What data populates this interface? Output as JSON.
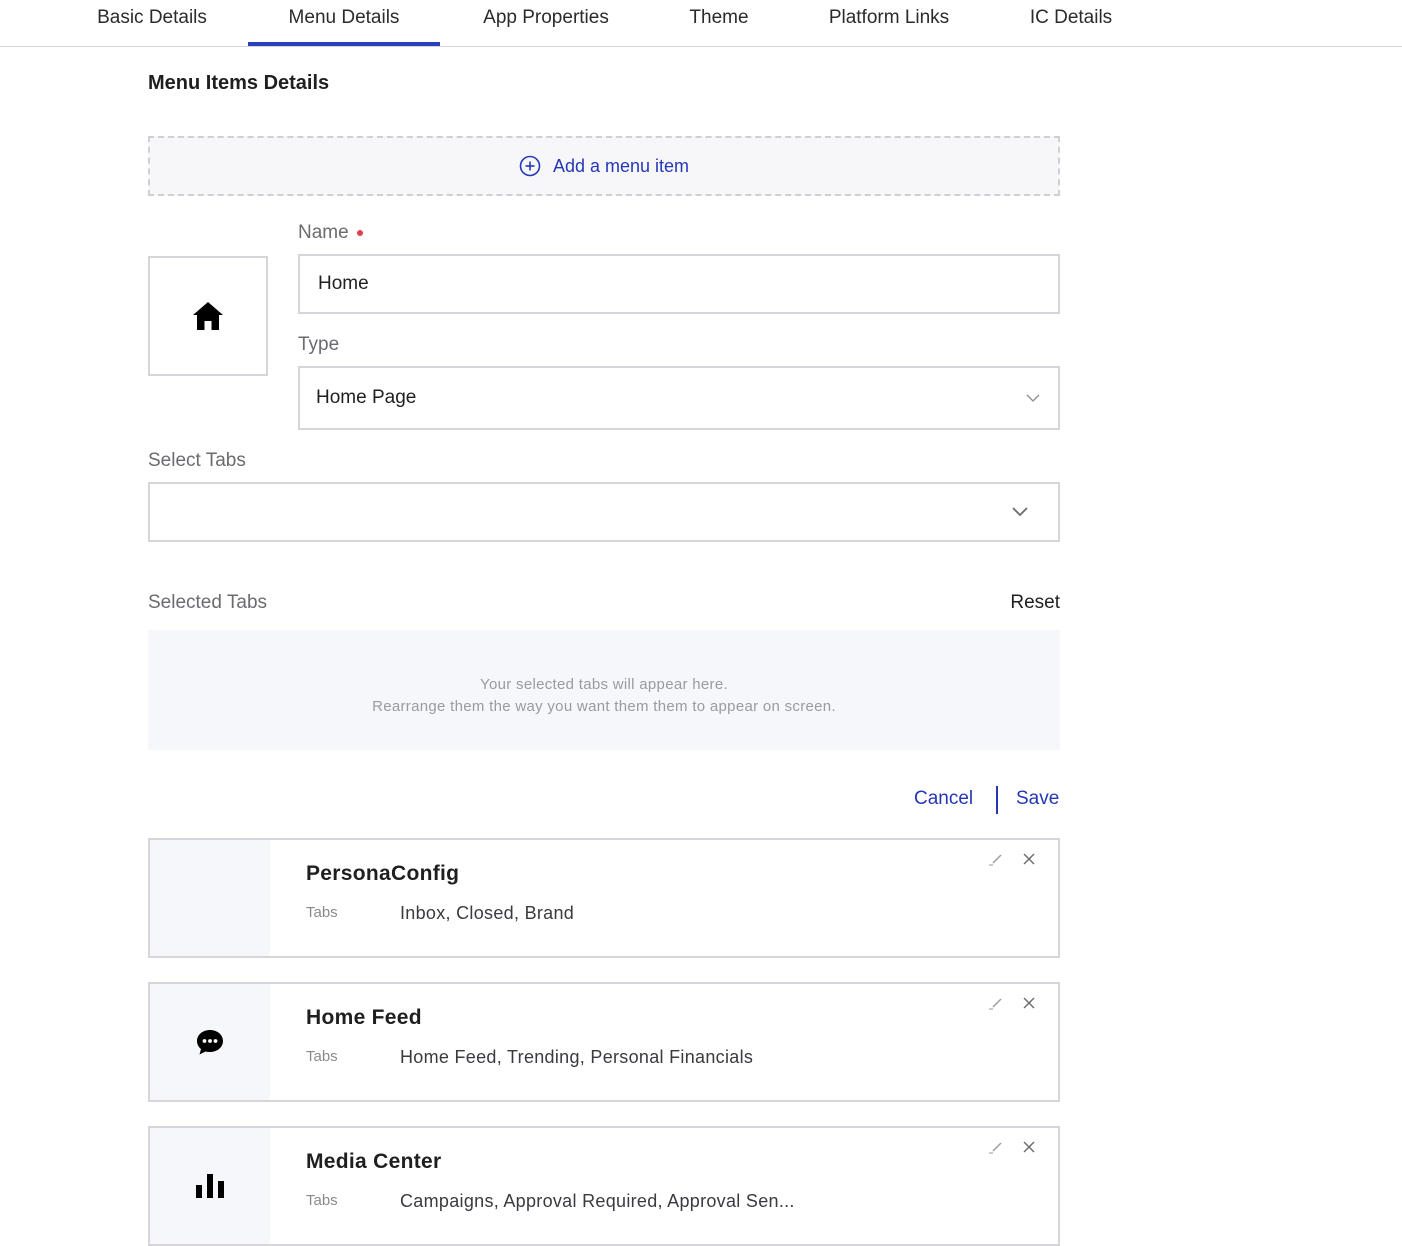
{
  "tabs": [
    {
      "label": "Basic Details"
    },
    {
      "label": "Menu Details"
    },
    {
      "label": "App Properties"
    },
    {
      "label": "Theme"
    },
    {
      "label": "Platform Links"
    },
    {
      "label": "IC Details"
    }
  ],
  "active_tab": "Menu Details",
  "section": {
    "title": "Menu Items Details",
    "add_label": "Add a menu item"
  },
  "form": {
    "icon": "home-icon",
    "name_label": "Name",
    "name_value": "Home",
    "type_label": "Type",
    "type_value": "Home Page",
    "select_tabs_label": "Select Tabs",
    "select_tabs_value": "",
    "selected_tabs_label": "Selected Tabs",
    "reset_label": "Reset",
    "empty_line1": "Your selected tabs will appear here.",
    "empty_line2": "Rearrange them the way you want them them to appear on screen.",
    "cancel_label": "Cancel",
    "save_label": "Save"
  },
  "menu_items": [
    {
      "title": "PersonaConfig",
      "tabs_label": "Tabs",
      "tabs": "Inbox, Closed, Brand",
      "icon": ""
    },
    {
      "title": "Home Feed",
      "tabs_label": "Tabs",
      "tabs": "Home Feed, Trending, Personal Financials",
      "icon": "chat-bubble-icon"
    },
    {
      "title": "Media Center",
      "tabs_label": "Tabs",
      "tabs": "Campaigns, Approval Required, Approval Sen...",
      "icon": "bar-chart-icon"
    }
  ],
  "colors": {
    "accent": "#2438b6",
    "required": "#e53f4f",
    "panel_bg": "#f6f7fb"
  }
}
